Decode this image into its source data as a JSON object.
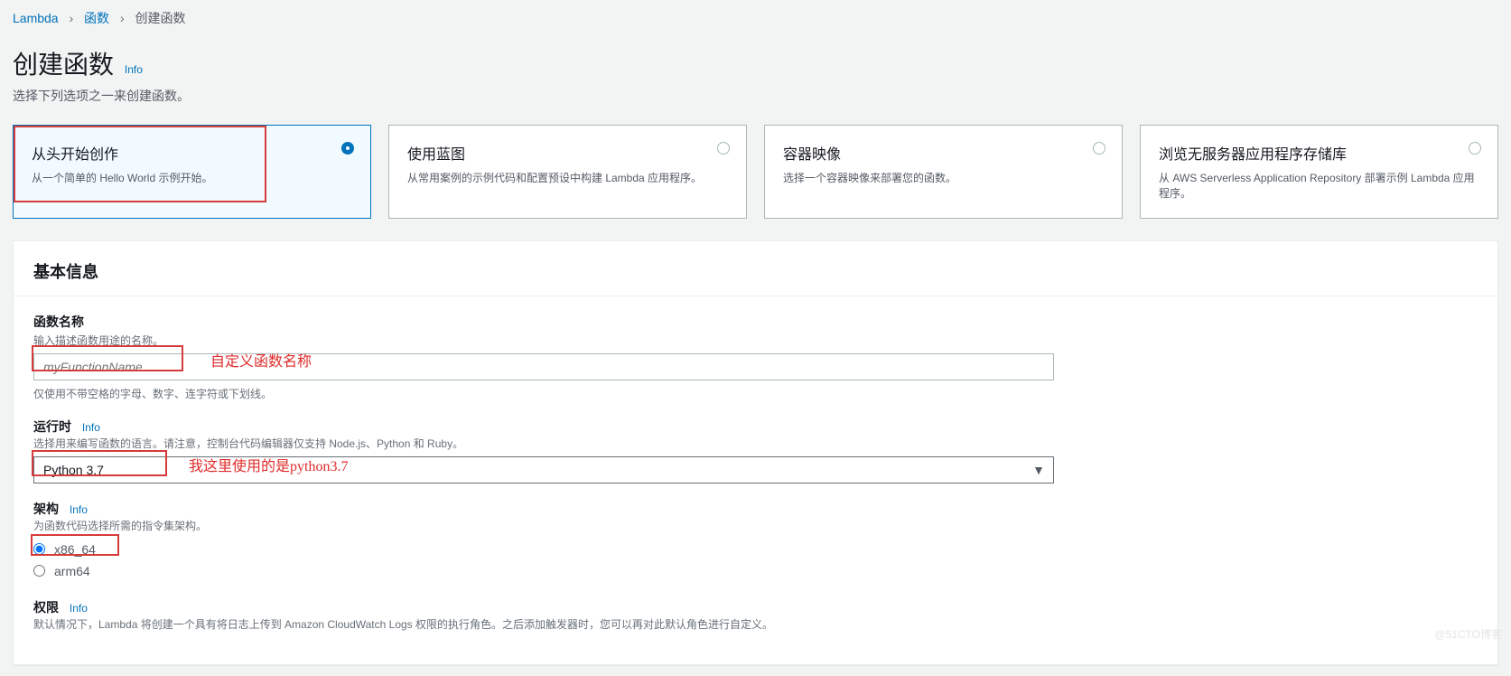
{
  "breadcrumb": {
    "root": "Lambda",
    "level1": "函数",
    "current": "创建函数"
  },
  "header": {
    "title": "创建函数",
    "info": "Info",
    "subtitle": "选择下列选项之一来创建函数。"
  },
  "options": [
    {
      "title": "从头开始创作",
      "desc": "从一个简单的 Hello World 示例开始。",
      "selected": true
    },
    {
      "title": "使用蓝图",
      "desc": "从常用案例的示例代码和配置预设中构建 Lambda 应用程序。",
      "selected": false
    },
    {
      "title": "容器映像",
      "desc": "选择一个容器映像来部署您的函数。",
      "selected": false
    },
    {
      "title": "浏览无服务器应用程序存储库",
      "desc": "从 AWS Serverless Application Repository 部署示例 Lambda 应用程序。",
      "selected": false
    }
  ],
  "panel": {
    "title": "基本信息"
  },
  "name": {
    "label": "函数名称",
    "hint": "输入描述函数用途的名称。",
    "placeholder": "myFunctionName",
    "hintBelow": "仅使用不带空格的字母、数字、连字符或下划线。",
    "annotation": "自定义函数名称"
  },
  "runtime": {
    "label": "运行时",
    "info": "Info",
    "hint": "选择用来编写函数的语言。请注意，控制台代码编辑器仅支持 Node.js、Python 和 Ruby。",
    "value": "Python 3.7",
    "annotation": "我这里使用的是python3.7"
  },
  "arch": {
    "label": "架构",
    "info": "Info",
    "hint": "为函数代码选择所需的指令集架构。",
    "options": [
      {
        "label": "x86_64",
        "checked": true
      },
      {
        "label": "arm64",
        "checked": false
      }
    ]
  },
  "perm": {
    "label": "权限",
    "info": "Info",
    "hint": "默认情况下，Lambda 将创建一个具有将日志上传到 Amazon CloudWatch Logs 权限的执行角色。之后添加触发器时，您可以再对此默认角色进行自定义。"
  },
  "watermark": "@51CTO博客"
}
